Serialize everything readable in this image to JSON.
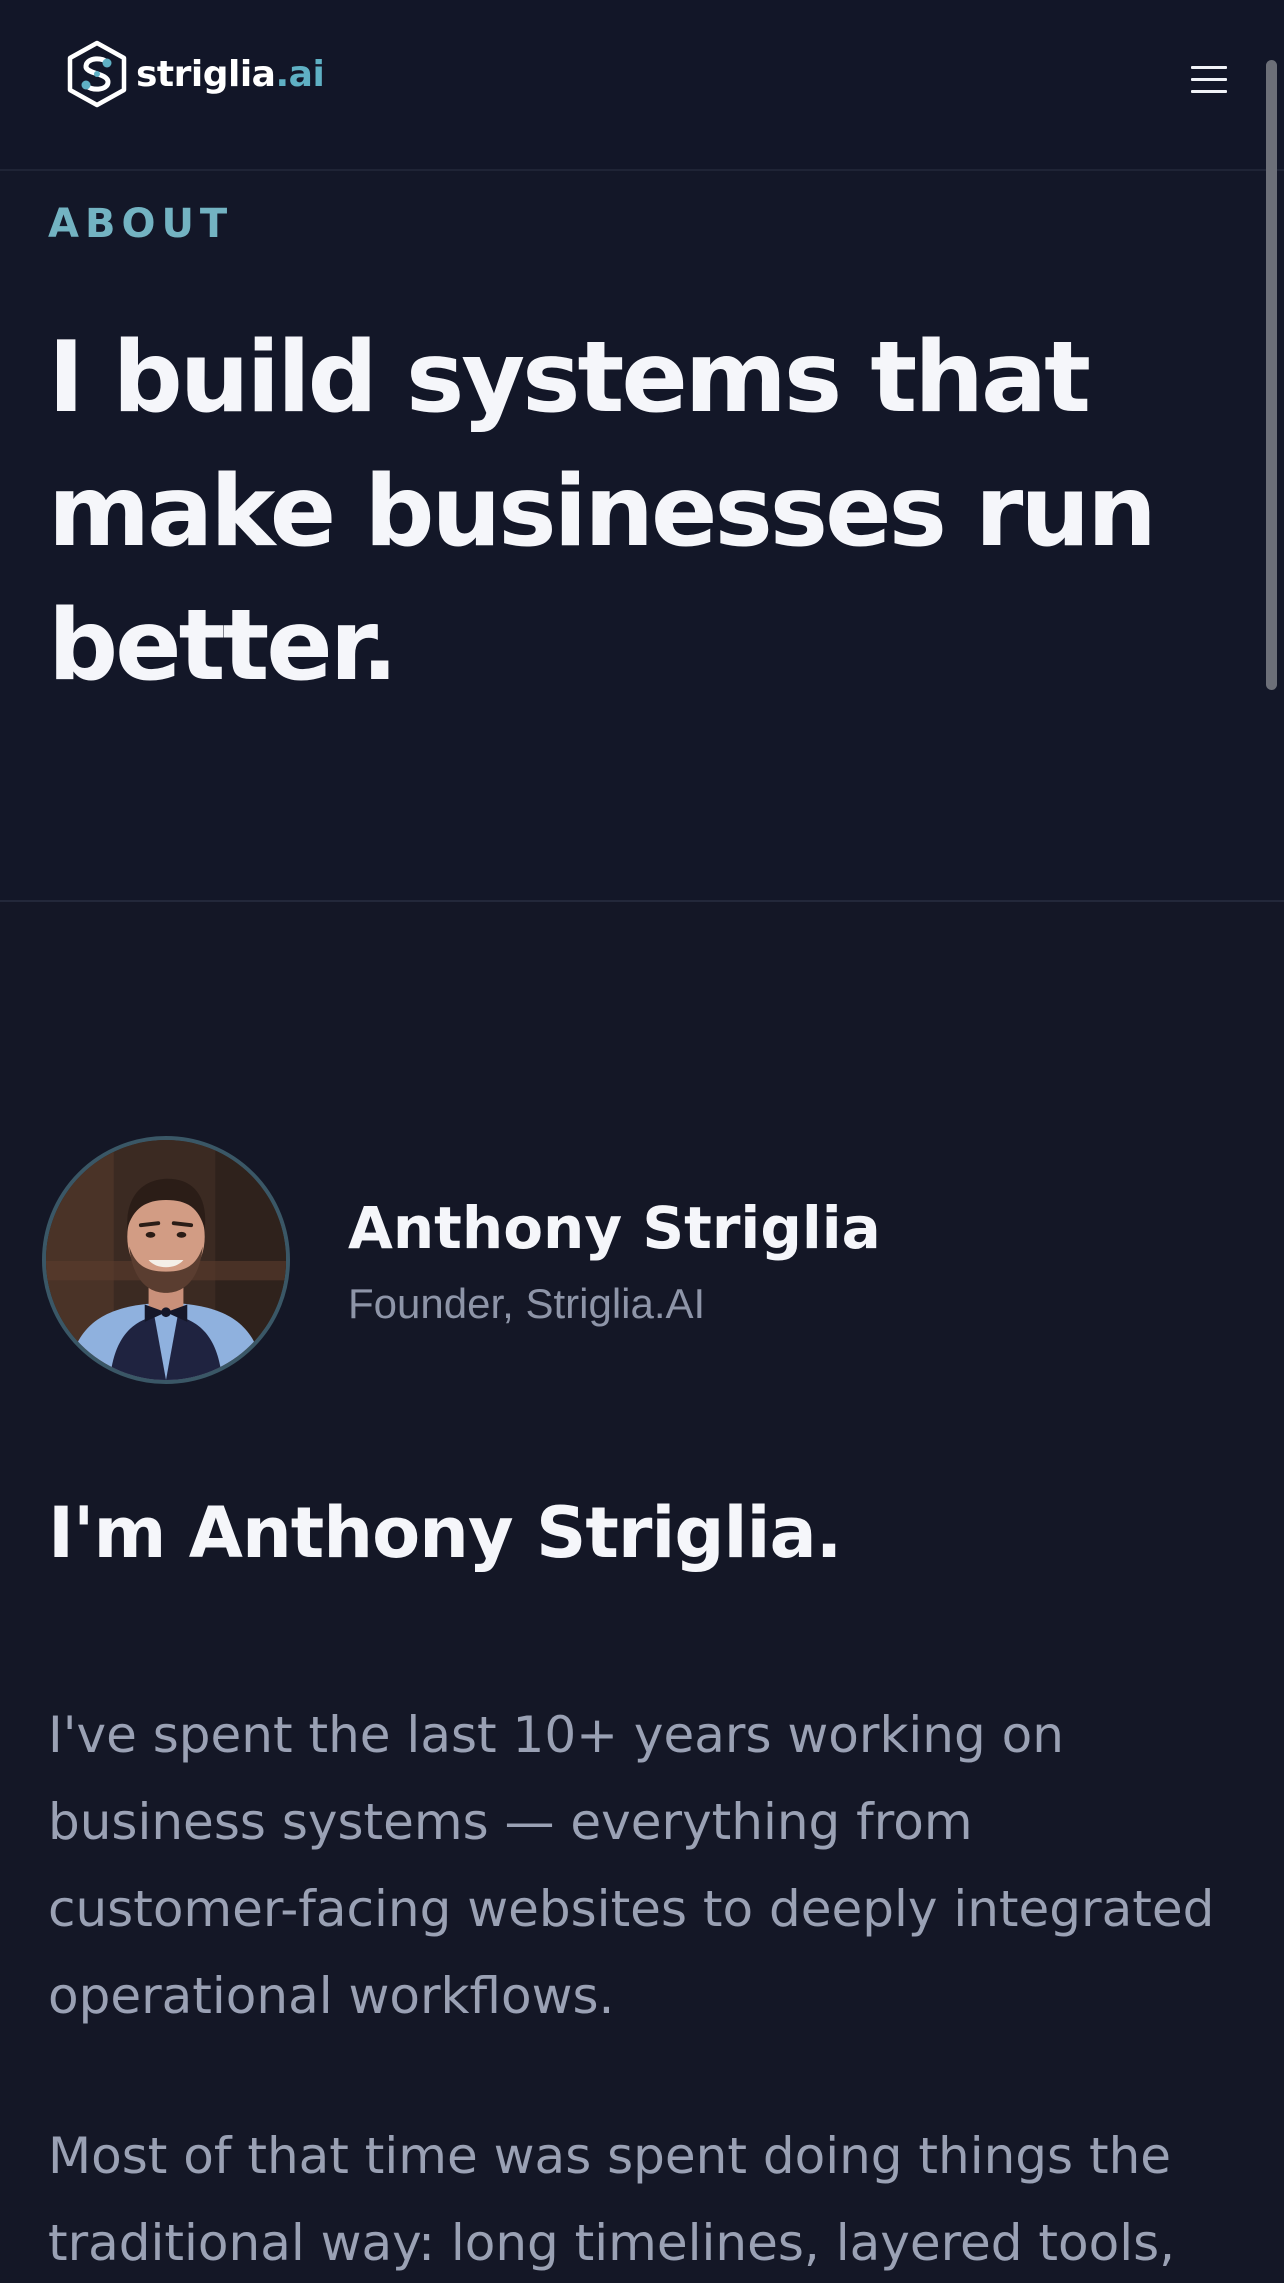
{
  "header": {
    "logo": {
      "name": "striglia",
      "tld": ".ai"
    },
    "menu_icon": "hamburger-menu-icon"
  },
  "hero": {
    "eyebrow": "ABOUT",
    "title": "I build systems that make businesses run better."
  },
  "profile": {
    "name": "Anthony Striglia",
    "role": "Founder, Striglia.AI"
  },
  "content": {
    "heading": "I'm Anthony Striglia.",
    "paragraphs": [
      "I've spent the last 10+ years working on business systems — everything from customer-facing websites to deeply integrated operational workflows.",
      "Most of that time was spent doing things the traditional way: long timelines, layered tools,"
    ]
  },
  "colors": {
    "background": "#141726",
    "header_background": "#121628",
    "accent": "#73b3c2",
    "heading_text": "#f5f6fa",
    "body_text": "#9aa1b4",
    "muted_text": "#8e95a8"
  }
}
